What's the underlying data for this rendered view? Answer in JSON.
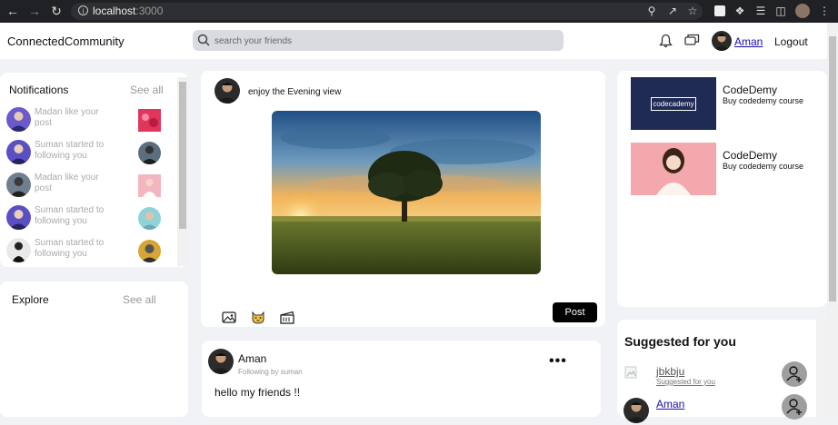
{
  "browser": {
    "url_host": "localhost",
    "url_port": ":3000"
  },
  "header": {
    "brand": "ConnectedCommunity",
    "search_placeholder": "search your friends",
    "user_name": "Aman",
    "logout_label": "Logout"
  },
  "notifications": {
    "title": "Notifications",
    "see_all": "See all",
    "items": [
      {
        "text": "Madan like your post"
      },
      {
        "text": "Suman started to following you"
      },
      {
        "text": "Madan like your post"
      },
      {
        "text": "Suman started to following you"
      },
      {
        "text": "Suman started to following you"
      }
    ]
  },
  "explore": {
    "title": "Explore",
    "see_all": "See all"
  },
  "composer": {
    "caption": "enjoy the Evening view",
    "post_label": "Post"
  },
  "feed": {
    "author": "Aman",
    "subtitle": "Following by suman",
    "more": "•••",
    "body": "hello my friends !!"
  },
  "ads": [
    {
      "title": "CodeDemy",
      "subtitle": "Buy codedemy course",
      "logo_text": "codecademy"
    },
    {
      "title": "CodeDemy",
      "subtitle": "Buy codedemy course"
    }
  ],
  "suggestions": {
    "title": "Suggested for you",
    "items": [
      {
        "name": "jbkbju",
        "subtitle": "Suggested for you"
      },
      {
        "name": "Aman"
      }
    ]
  },
  "colors": {
    "accent_link": "#1a0dab",
    "post_button": "#000000",
    "page_bg": "#f0f2f5"
  }
}
